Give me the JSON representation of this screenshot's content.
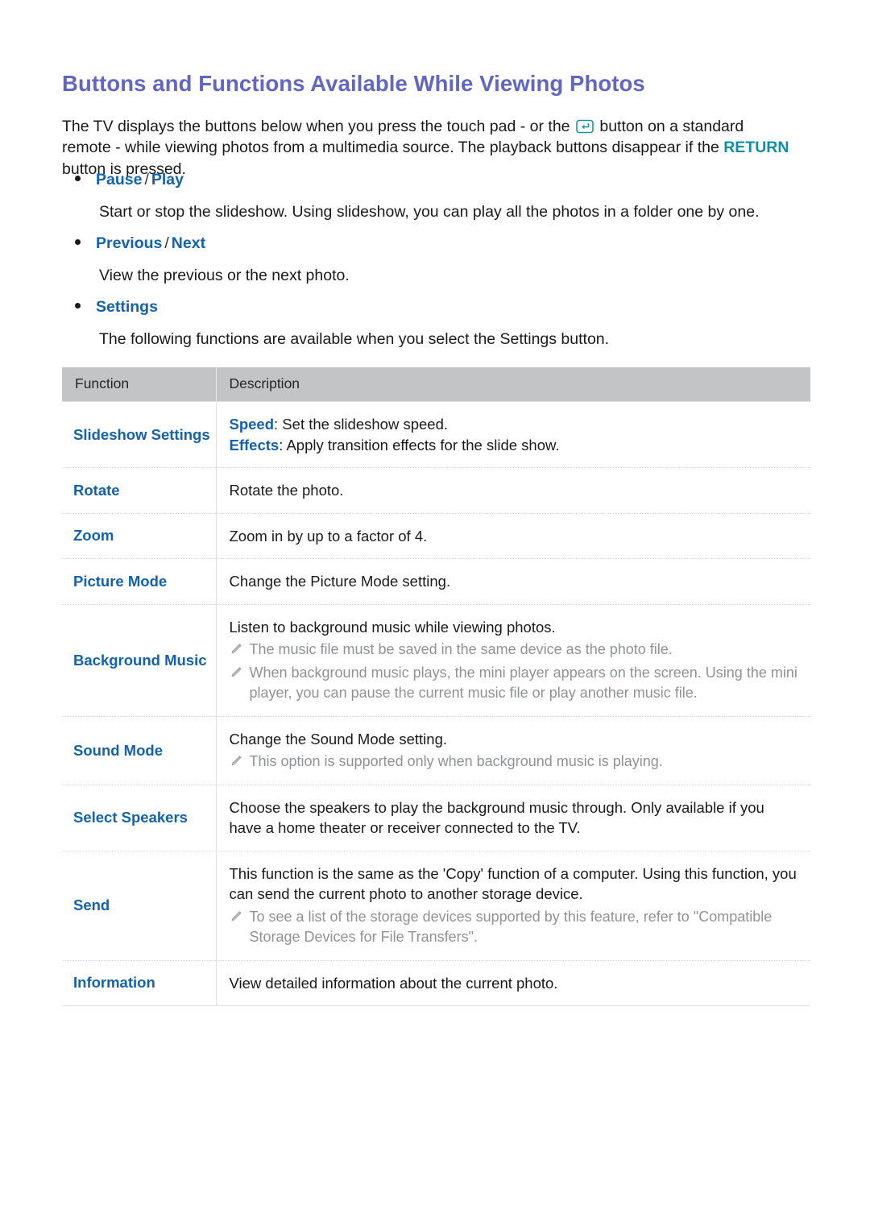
{
  "document": {
    "title": "Buttons and Functions Available While Viewing Photos",
    "intro": {
      "part1": "The TV displays the buttons below when you press the touch pad - or the ",
      "enter_icon": "enter-button-icon",
      "part2": " button on a standard remote - while viewing photos from a multimedia source. The playback buttons disappear if the ",
      "return_keyword": "RETURN",
      "part3": " button is pressed."
    }
  },
  "bullets": [
    {
      "label_a": "Pause",
      "separator": "/",
      "label_b": "Play",
      "description": "Start or stop the slideshow. Using slideshow, you can play all the photos in a folder one by one."
    },
    {
      "label_a": "Previous",
      "separator": "/",
      "label_b": "Next",
      "description": "View the previous or the next photo."
    },
    {
      "label_a": "Settings",
      "separator": "",
      "label_b": "",
      "description": "The following functions are available when you select the Settings button."
    }
  ],
  "table": {
    "headers": [
      "Function",
      "Description"
    ],
    "rows": [
      {
        "function": "Slideshow Settings",
        "lines": [
          {
            "keyword": "Speed",
            "text": ": Set the slideshow speed."
          },
          {
            "keyword": "Effects",
            "text": ": Apply transition effects for the slide show."
          }
        ],
        "notes": []
      },
      {
        "function": "Rotate",
        "lines": [
          {
            "keyword": "",
            "text": "Rotate the photo."
          }
        ],
        "notes": []
      },
      {
        "function": "Zoom",
        "lines": [
          {
            "keyword": "",
            "text": "Zoom in by up to a factor of 4."
          }
        ],
        "notes": []
      },
      {
        "function": "Picture Mode",
        "lines": [
          {
            "keyword": "",
            "text": "Change the Picture Mode setting."
          }
        ],
        "notes": []
      },
      {
        "function": "Background Music",
        "lines": [
          {
            "keyword": "",
            "text": "Listen to background music while viewing photos."
          }
        ],
        "notes": [
          "The music file must be saved in the same device as the photo file.",
          "When background music plays, the mini player appears on the screen. Using the mini player, you can pause the current music file or play another music file."
        ]
      },
      {
        "function": "Sound Mode",
        "lines": [
          {
            "keyword": "",
            "text": "Change the Sound Mode setting."
          }
        ],
        "notes": [
          "This option is supported only when background music is playing."
        ]
      },
      {
        "function": "Select Speakers",
        "lines": [
          {
            "keyword": "",
            "text": "Choose the speakers to play the background music through. Only available if you have a home theater or receiver connected to the TV."
          }
        ],
        "notes": []
      },
      {
        "function": "Send",
        "lines": [
          {
            "keyword": "",
            "text": "This function is the same as the 'Copy' function of a computer. Using this function, you can send the current photo to another storage device."
          }
        ],
        "notes": [
          "To see a list of the storage devices supported by this feature, refer to \"Compatible Storage Devices for File Transfers\"."
        ]
      },
      {
        "function": "Information",
        "lines": [
          {
            "keyword": "",
            "text": "View detailed information about the current photo."
          }
        ],
        "notes": []
      }
    ]
  },
  "colors": {
    "title": "#6166c4",
    "link_blue": "#1262ad",
    "return_teal": "#0f8fa4",
    "table_header_bg": "#c2c4c6",
    "note_gray": "#8f9295",
    "body_text": "#1a1a1a"
  }
}
